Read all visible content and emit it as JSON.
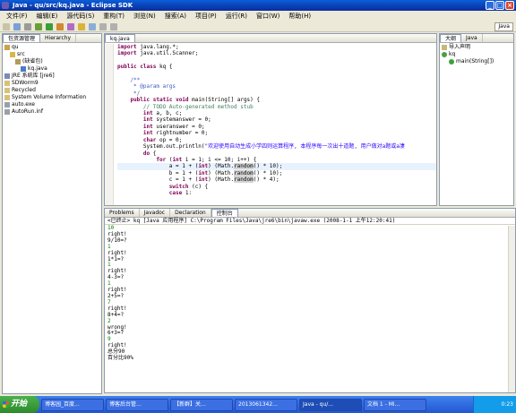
{
  "window": {
    "title": "Java - qu/src/kq.java - Eclipse SDK",
    "btn_min": "_",
    "btn_max": "□",
    "btn_close": "×"
  },
  "menu": [
    "文件(F)",
    "编辑(E)",
    "源代码(S)",
    "重构(T)",
    "浏览(N)",
    "搜索(A)",
    "项目(P)",
    "运行(R)",
    "窗口(W)",
    "帮助(H)"
  ],
  "perspective": "Java",
  "left_panel": {
    "tabs": [
      "包资源管理",
      "Hierarchy"
    ],
    "tree": [
      {
        "label": "qu",
        "indent": 0
      },
      {
        "label": "src",
        "indent": 1
      },
      {
        "label": "(缺省包)",
        "indent": 2
      },
      {
        "label": "kq.java",
        "indent": 3
      },
      {
        "label": "JRE 系统库 [jre6]",
        "indent": 0
      },
      {
        "label": "SDWorm9",
        "indent": 0
      },
      {
        "label": "Recycled",
        "indent": 0
      },
      {
        "label": "System Volume Information",
        "indent": 0
      },
      {
        "label": "auto.exe",
        "indent": 0
      },
      {
        "label": "AutoRun.inf",
        "indent": 0
      }
    ]
  },
  "editor": {
    "tab": "kq.java",
    "lines": [
      "import java.lang.*;",
      "import java.util.Scanner;",
      "",
      "public class kq {",
      "",
      "    /**",
      "     * @param args",
      "     */",
      "    public static void main(String[] args) {",
      "        // TODO Auto-generated method stub",
      "        int a, b, c;",
      "        int systemanswer = 0;",
      "        int useranswer = 0;",
      "        int rightnumber = 0;",
      "        char op = 0;",
      "        System.out.println(\"欢迎使用自动生成小学四则运算程序, 本程序每一次出十道题, 用户做对a题或a凄",
      "        do {",
      "            for (int i = 1; i <= 10; i++) {",
      "                a = 1 + (int) (Math.random() * 10);",
      "                b = 1 + (int) (Math.random() * 10);",
      "                c = 1 + (int) (Math.random() * 4);",
      "                switch (c) {",
      "                case 1:"
    ]
  },
  "outline": {
    "tabs": [
      "大纲",
      "Java"
    ],
    "items": [
      "导入声明",
      "kq",
      "main(String[])"
    ]
  },
  "console": {
    "tabs": [
      "Problems",
      "Javadoc",
      "Declaration",
      "控制台"
    ],
    "header": "<已终止> kq [Java 应用程序] C:\\Program Files\\Java\\jre6\\bin\\javaw.exe (2008-1-1 上午12:20:41)",
    "lines": [
      {
        "t": "10",
        "in": true
      },
      {
        "t": "right!",
        "in": false
      },
      {
        "t": "9/10=?",
        "in": false
      },
      {
        "t": "1",
        "in": true
      },
      {
        "t": "right!",
        "in": false
      },
      {
        "t": "1*1=?",
        "in": false
      },
      {
        "t": "1",
        "in": true
      },
      {
        "t": "right!",
        "in": false
      },
      {
        "t": "4-3=?",
        "in": false
      },
      {
        "t": "1",
        "in": true
      },
      {
        "t": "right!",
        "in": false
      },
      {
        "t": "2+5=?",
        "in": false
      },
      {
        "t": "7",
        "in": true
      },
      {
        "t": "right!",
        "in": false
      },
      {
        "t": "8+4=?",
        "in": false
      },
      {
        "t": "2",
        "in": true
      },
      {
        "t": "wrong!",
        "in": false
      },
      {
        "t": "6+3=?",
        "in": false
      },
      {
        "t": "9",
        "in": true
      },
      {
        "t": "right!",
        "in": false
      },
      {
        "t": "总分90",
        "in": false
      },
      {
        "t": "百分比90%",
        "in": false
      }
    ]
  },
  "taskbar": {
    "start": "开始",
    "tasks": [
      "博客园_百度...",
      "博客后台管...",
      "【新群】关...",
      "2013061342...",
      "Java - qu/...",
      "文档 1 - Mi..."
    ],
    "active_index": 4,
    "clock": "0:23"
  },
  "colors": {
    "keyword": "#7f0055",
    "comment": "#3f7f5f",
    "string": "#2a00ff",
    "console_input": "#008000"
  }
}
